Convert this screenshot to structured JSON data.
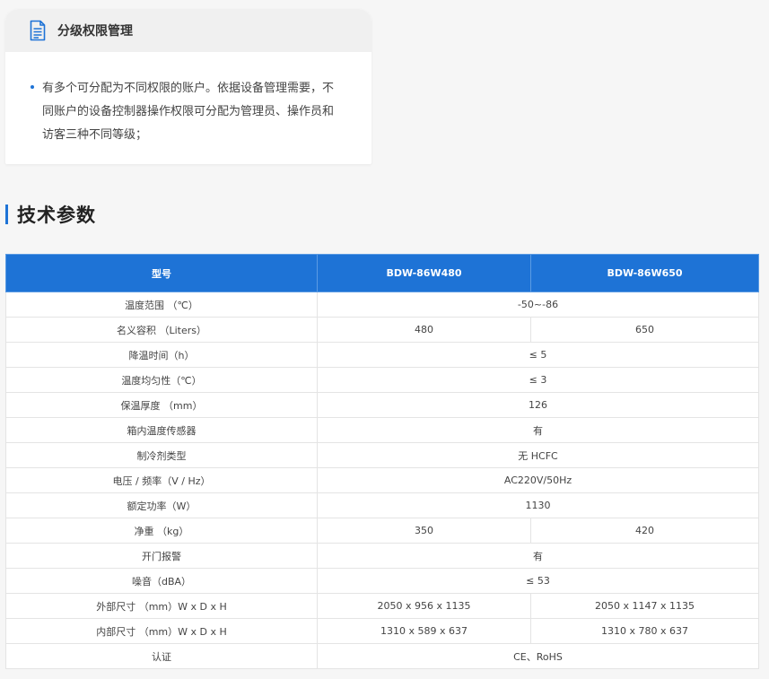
{
  "feature_card": {
    "title": "分级权限管理",
    "icon": "document-icon",
    "bullet": "有多个可分配为不同权限的账户。依据设备管理需要，不同账户的设备控制器操作权限可分配为管理员、操作员和访客三种不同等级；"
  },
  "section": {
    "title": "技术参数"
  },
  "table": {
    "headers": [
      "型号",
      "BDW-86W480",
      "BDW-86W650"
    ],
    "rows": [
      {
        "label": "温度范围 （℃）",
        "value": "-50~-86"
      },
      {
        "label": "名义容积 （Liters）",
        "values": [
          "480",
          "650"
        ]
      },
      {
        "label": "降温时间（h）",
        "value": "≤ 5"
      },
      {
        "label": "温度均匀性（℃）",
        "value": "≤ 3"
      },
      {
        "label": "保温厚度 （mm）",
        "value": "126"
      },
      {
        "label": "箱内温度传感器",
        "value": "有"
      },
      {
        "label": "制冷剂类型",
        "value": "无 HCFC"
      },
      {
        "label": "电压 / 频率（V / Hz）",
        "value": "AC220V/50Hz"
      },
      {
        "label": "额定功率（W）",
        "value": "1130"
      },
      {
        "label": "净重 （kg）",
        "values": [
          "350",
          "420"
        ]
      },
      {
        "label": "开门报警",
        "value": "有"
      },
      {
        "label": "噪音（dBA）",
        "value": "≤ 53"
      },
      {
        "label": "外部尺寸 （mm）W x D x H",
        "values": [
          "2050 x 956 x 1135",
          "2050 x 1147 x 1135"
        ]
      },
      {
        "label": "内部尺寸 （mm）W x D x H",
        "values": [
          "1310 x 589 x 637",
          "1310 x 780 x 637"
        ]
      },
      {
        "label": "认证",
        "value": "CE、RoHS"
      }
    ]
  }
}
